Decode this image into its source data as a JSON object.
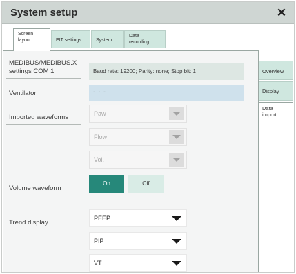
{
  "window": {
    "title": "System setup",
    "close_icon": "close-icon"
  },
  "tabs": [
    {
      "line1": "Screen",
      "line2": "layout",
      "active": true
    },
    {
      "line1": "EIT settings",
      "line2": "",
      "active": false
    },
    {
      "line1": "System",
      "line2": "",
      "active": false
    },
    {
      "line1": "Data",
      "line2": "recording",
      "active": false
    }
  ],
  "side_tabs": [
    {
      "line1": "Overview",
      "line2": "",
      "active": false
    },
    {
      "line1": "Display",
      "line2": "",
      "active": false
    },
    {
      "line1": "Data",
      "line2": "import",
      "active": true
    }
  ],
  "settings": {
    "com_label_1": "MEDIBUS/MEDIBUS.X",
    "com_label_2": "settings COM 1",
    "com_info": "Baud rate: 19200; Parity: none; Stop bit: 1",
    "ventilator_label": "Ventilator",
    "ventilator_value": "- - -",
    "imported_waveforms_label": "Imported waveforms",
    "waveforms": [
      "Paw",
      "Flow",
      "Vol."
    ],
    "volume_waveform_label": "Volume waveform",
    "volume_waveform_on": "On",
    "volume_waveform_off": "Off",
    "volume_waveform_state": "On",
    "trend_display_label": "Trend display",
    "trends": [
      "PEEP",
      "PIP",
      "VT"
    ]
  }
}
